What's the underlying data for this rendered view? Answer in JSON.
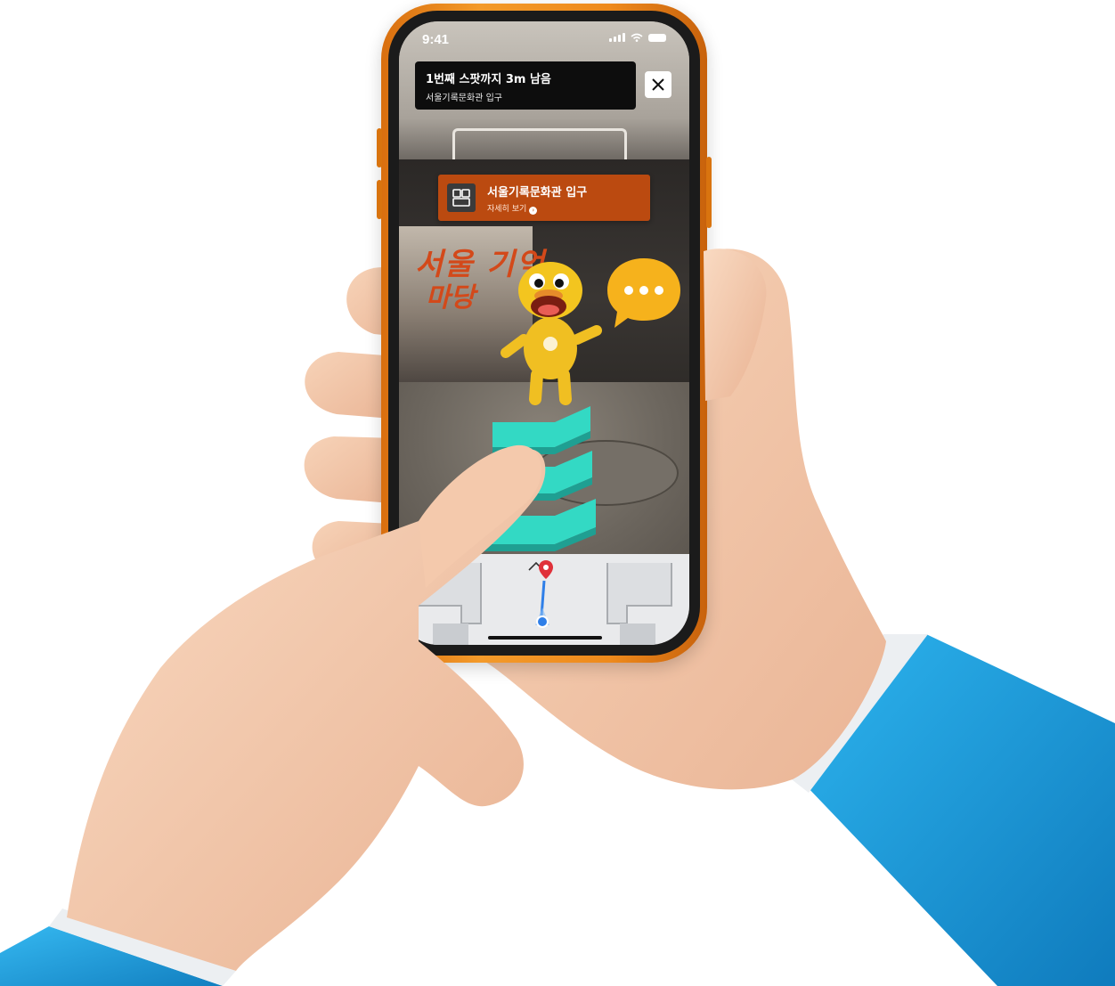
{
  "status_bar": {
    "time": "9:41"
  },
  "navigation": {
    "instruction": "1번째 스팟까지 3m 남음",
    "destination": "서울기록문화관 입구"
  },
  "poi_card": {
    "title": "서울기록문화관 입구",
    "detail_link": "자세히 보기"
  },
  "icons": {
    "close": "close-icon",
    "poi": "building-icon",
    "arrow": "chevron-right-icon",
    "speech": "speech-bubble-icon",
    "location_pin": "location-pin-icon",
    "current_location": "current-location-icon"
  },
  "colors": {
    "phone_frame": "#f08c1e",
    "poi_card": "#bb4a10",
    "ar_arrow": "#2fd6c0",
    "map_pin": "#e0313a",
    "map_route": "#2f7fe8",
    "sleeve": "#1e95d6"
  }
}
